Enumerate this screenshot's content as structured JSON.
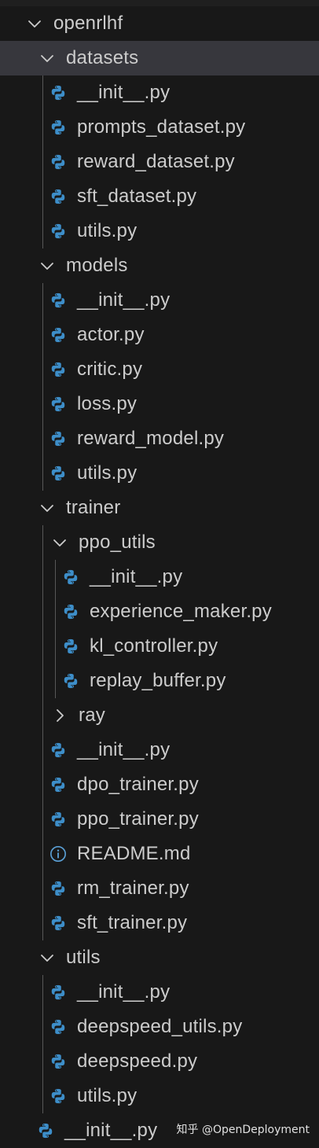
{
  "explorer": {
    "rows": [
      {
        "kind": "folder",
        "label": "openrlhf",
        "expanded": true,
        "depth": 0
      },
      {
        "kind": "folder",
        "label": "datasets",
        "expanded": true,
        "depth": 1,
        "selected": true
      },
      {
        "kind": "file",
        "icon": "python",
        "label": "__init__.py",
        "depth": 2
      },
      {
        "kind": "file",
        "icon": "python",
        "label": "prompts_dataset.py",
        "depth": 2
      },
      {
        "kind": "file",
        "icon": "python",
        "label": "reward_dataset.py",
        "depth": 2
      },
      {
        "kind": "file",
        "icon": "python",
        "label": "sft_dataset.py",
        "depth": 2
      },
      {
        "kind": "file",
        "icon": "python",
        "label": "utils.py",
        "depth": 2
      },
      {
        "kind": "folder",
        "label": "models",
        "expanded": true,
        "depth": 1
      },
      {
        "kind": "file",
        "icon": "python",
        "label": "__init__.py",
        "depth": 2
      },
      {
        "kind": "file",
        "icon": "python",
        "label": "actor.py",
        "depth": 2
      },
      {
        "kind": "file",
        "icon": "python",
        "label": "critic.py",
        "depth": 2
      },
      {
        "kind": "file",
        "icon": "python",
        "label": "loss.py",
        "depth": 2
      },
      {
        "kind": "file",
        "icon": "python",
        "label": "reward_model.py",
        "depth": 2
      },
      {
        "kind": "file",
        "icon": "python",
        "label": "utils.py",
        "depth": 2
      },
      {
        "kind": "folder",
        "label": "trainer",
        "expanded": true,
        "depth": 1
      },
      {
        "kind": "folder",
        "label": "ppo_utils",
        "expanded": true,
        "depth": 2
      },
      {
        "kind": "file",
        "icon": "python",
        "label": "__init__.py",
        "depth": 3
      },
      {
        "kind": "file",
        "icon": "python",
        "label": "experience_maker.py",
        "depth": 3
      },
      {
        "kind": "file",
        "icon": "python",
        "label": "kl_controller.py",
        "depth": 3
      },
      {
        "kind": "file",
        "icon": "python",
        "label": "replay_buffer.py",
        "depth": 3
      },
      {
        "kind": "folder",
        "label": "ray",
        "expanded": false,
        "depth": 2
      },
      {
        "kind": "file",
        "icon": "python",
        "label": "__init__.py",
        "depth": 2
      },
      {
        "kind": "file",
        "icon": "python",
        "label": "dpo_trainer.py",
        "depth": 2
      },
      {
        "kind": "file",
        "icon": "python",
        "label": "ppo_trainer.py",
        "depth": 2
      },
      {
        "kind": "file",
        "icon": "info",
        "label": "README.md",
        "depth": 2
      },
      {
        "kind": "file",
        "icon": "python",
        "label": "rm_trainer.py",
        "depth": 2
      },
      {
        "kind": "file",
        "icon": "python",
        "label": "sft_trainer.py",
        "depth": 2
      },
      {
        "kind": "folder",
        "label": "utils",
        "expanded": true,
        "depth": 1
      },
      {
        "kind": "file",
        "icon": "python",
        "label": "__init__.py",
        "depth": 2
      },
      {
        "kind": "file",
        "icon": "python",
        "label": "deepspeed_utils.py",
        "depth": 2
      },
      {
        "kind": "file",
        "icon": "python",
        "label": "deepspeed.py",
        "depth": 2
      },
      {
        "kind": "file",
        "icon": "python",
        "label": "utils.py",
        "depth": 2
      },
      {
        "kind": "file",
        "icon": "python",
        "label": "__init__.py",
        "depth": 1
      }
    ]
  },
  "watermark": {
    "text": "知乎 @OpenDeployment"
  },
  "colors": {
    "python_icon": "#3d8ec9",
    "info_icon": "#5a9fd4",
    "chevron": "#cccccc",
    "selected_row": "#37373d",
    "background": "#181818"
  }
}
